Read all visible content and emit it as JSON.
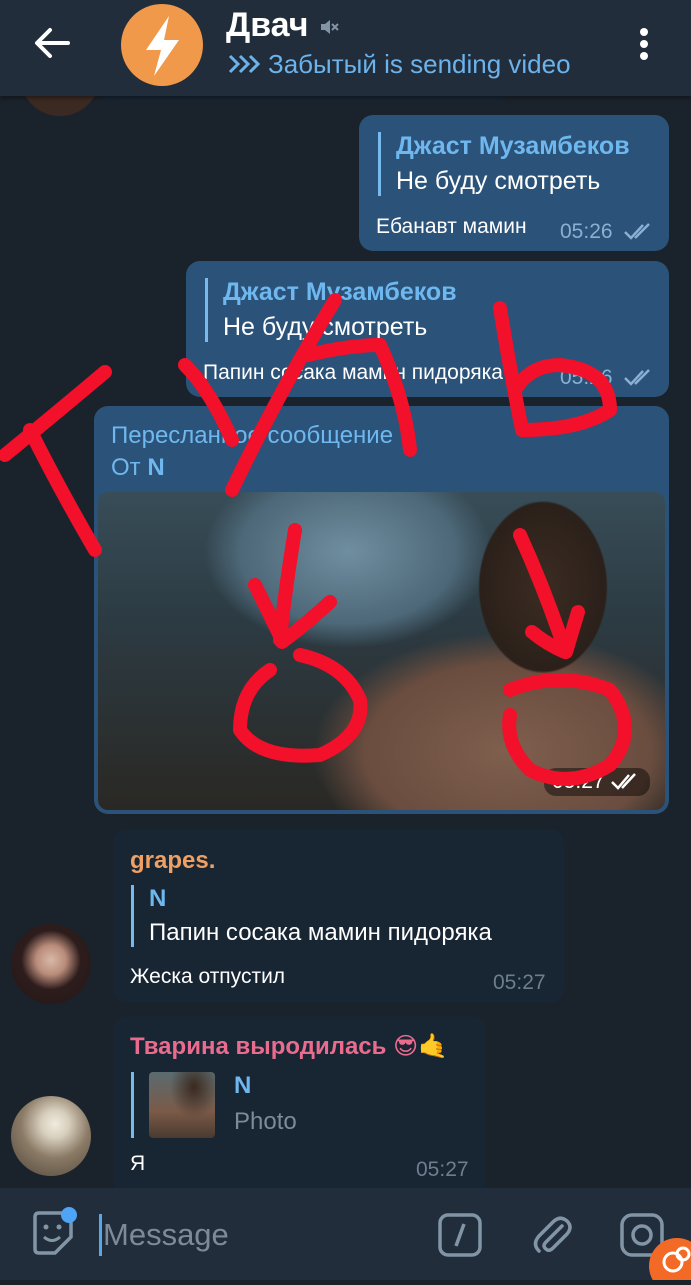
{
  "header": {
    "title": "Двач",
    "status_name": "Забытый",
    "status_action": "is sending video"
  },
  "messages": [
    {
      "reply_name": "Джаст Музамбеков",
      "reply_text": "Не буду смотреть",
      "text": "Ебанавт мамин",
      "time": "05:26"
    },
    {
      "reply_name": "Джаст Музамбеков",
      "reply_text": "Не буду смотреть",
      "text": "Папин сосака мамин пидоряка",
      "time": "05:26"
    },
    {
      "forward_label": "Пересланное сообщение",
      "forward_prefix": "От",
      "forward_from": "N",
      "time": "05:27"
    },
    {
      "sender": "grapes.",
      "reply_name": "N",
      "reply_text": "Папин сосака мамин пидоряка",
      "text": "Жеска отпустил",
      "time": "05:27"
    },
    {
      "sender": "Тварина выродилась 😎🤙",
      "reply_name": "N",
      "reply_text": "Photo",
      "text": "Я",
      "time": "05:27"
    }
  ],
  "overlay_text": "ТУТЬ",
  "input": {
    "placeholder": "Message"
  },
  "colors": {
    "background": "#1a222c",
    "header": "#212d3b",
    "outgoing_bubble": "#2b5278",
    "incoming_bubble": "#182533",
    "accent": "#6fb8ef",
    "sender_grapes": "#f0a062",
    "sender_tvarina": "#e96c8e",
    "scribble": "#f2102a"
  },
  "icons": [
    "back-arrow-icon",
    "bolt-icon",
    "mute-icon",
    "more-vert-icon",
    "double-check-icon",
    "sticker-icon",
    "slash-command-icon",
    "paperclip-icon",
    "camera-icon"
  ]
}
